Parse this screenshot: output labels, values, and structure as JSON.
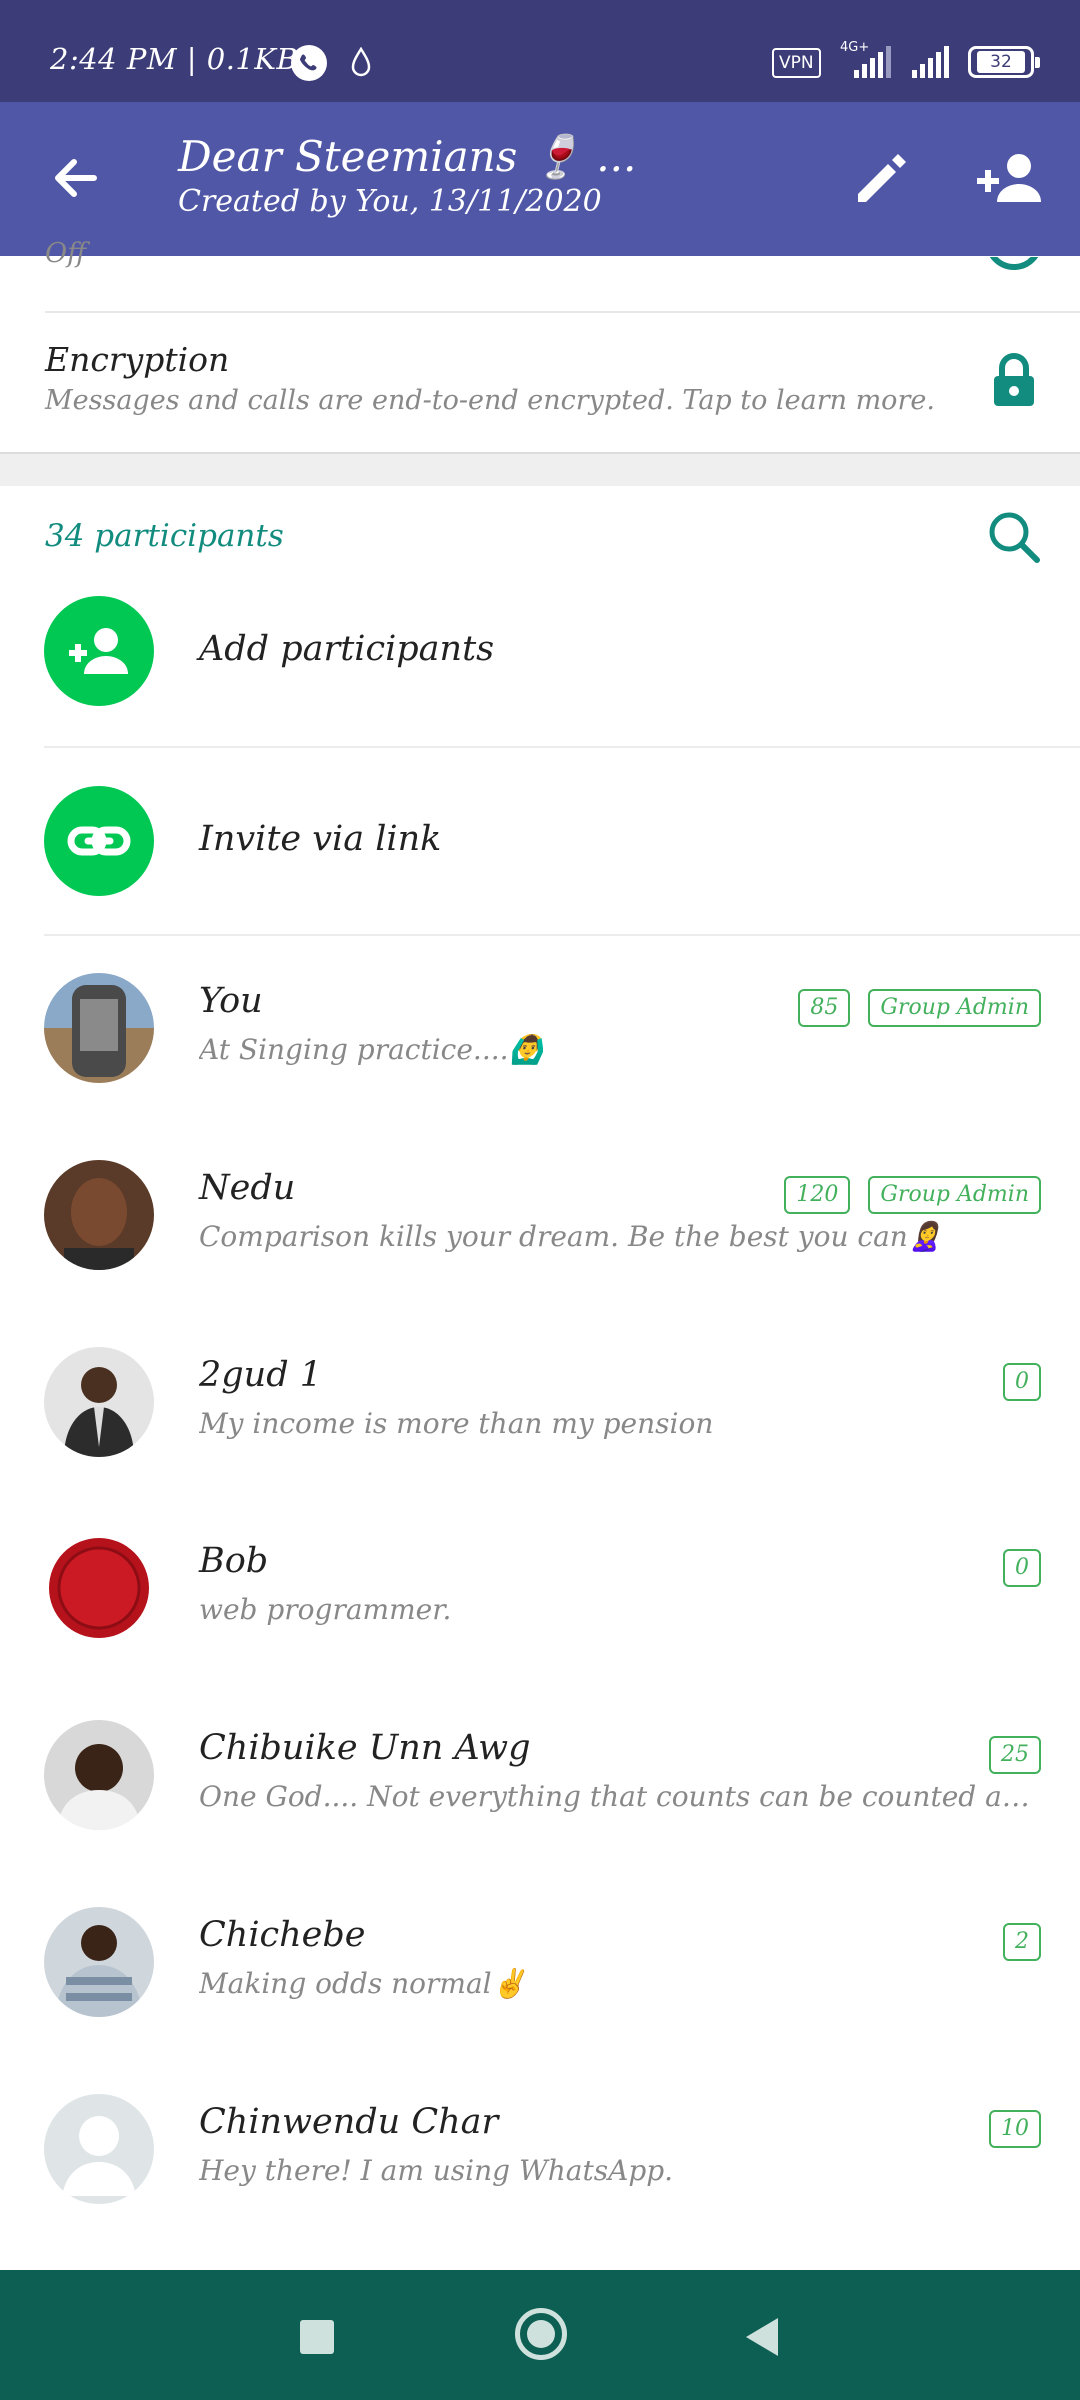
{
  "status_bar": {
    "time": "2:44 PM | 0.1KB/s",
    "vpn": "VPN",
    "network": "4G+",
    "battery": "32"
  },
  "header": {
    "title": "Dear Steemians 🍷 ...",
    "subtitle": "Created by You, 13/11/2020"
  },
  "settings": {
    "previous_value": "Off",
    "encryption_title": "Encryption",
    "encryption_subtitle": "Messages and calls are end-to-end encrypted. Tap to learn more."
  },
  "participants": {
    "count_label": "34 participants",
    "add_label": "Add participants",
    "invite_label": "Invite via link",
    "list": [
      {
        "name": "You",
        "status": "At Singing practice....🙆‍♂️",
        "badges": [
          "85",
          "Group Admin"
        ]
      },
      {
        "name": "Nedu",
        "status": "Comparison kills your dream. Be the best you can🙎‍♀️",
        "badges": [
          "120",
          "Group Admin"
        ]
      },
      {
        "name": "2gud 1",
        "status": "My income is more than my pension",
        "badges": [
          "0"
        ]
      },
      {
        "name": "Bob",
        "status": "web programmer.",
        "badges": [
          "0"
        ]
      },
      {
        "name": "Chibuike Unn Awg",
        "status": "One God.... Not everything that counts can be counted and is not eve...",
        "badges": [
          "25"
        ]
      },
      {
        "name": "Chichebe",
        "status": "Making odds normal✌️",
        "badges": [
          "2"
        ]
      },
      {
        "name": "Chinwendu Char",
        "status": "Hey there! I am using WhatsApp.",
        "badges": [
          "10"
        ]
      }
    ]
  },
  "icons": {
    "back": "arrow-left-icon",
    "edit": "pencil-icon",
    "add_person": "person-add-icon",
    "lock": "lock-icon",
    "search": "search-icon",
    "link": "link-icon"
  },
  "colors": {
    "app_bar": "#5057a6",
    "status_bar": "#3c3c78",
    "accent": "#128c7e",
    "action_green": "#00c853",
    "badge_green": "#43b05c",
    "nav_bar": "#0c5f52"
  }
}
